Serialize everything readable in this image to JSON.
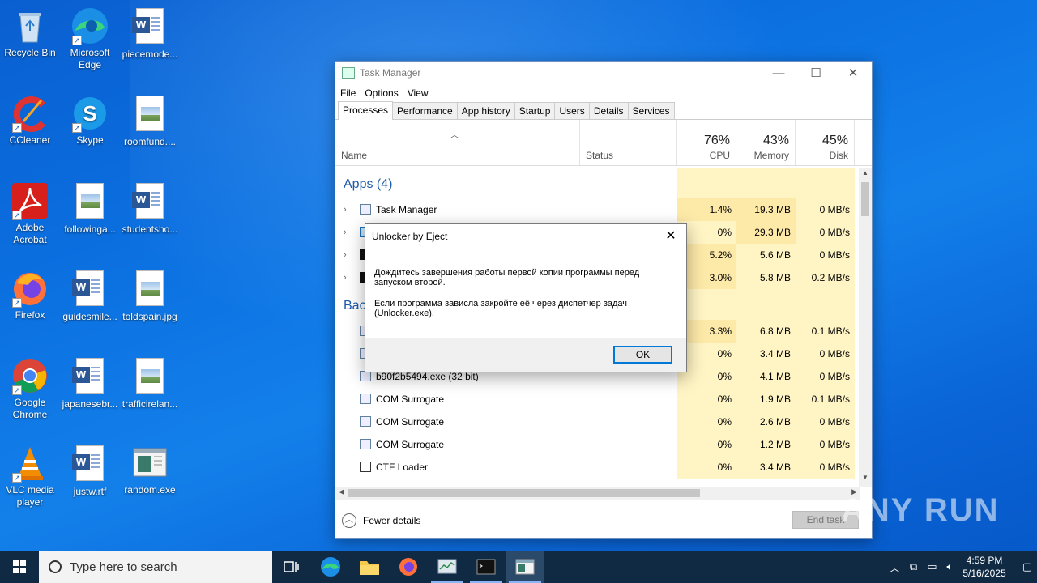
{
  "desktop": {
    "icons": [
      {
        "label": "Recycle Bin"
      },
      {
        "label": "Microsoft Edge"
      },
      {
        "label": "piecemode..."
      },
      {
        "label": "CCleaner"
      },
      {
        "label": "Skype"
      },
      {
        "label": "roomfund...."
      },
      {
        "label": "Adobe Acrobat"
      },
      {
        "label": "followinga..."
      },
      {
        "label": "studentsho..."
      },
      {
        "label": "Firefox"
      },
      {
        "label": "guidesmile..."
      },
      {
        "label": "toldspain.jpg"
      },
      {
        "label": "Google Chrome"
      },
      {
        "label": "japanesebr..."
      },
      {
        "label": "trafficirelan..."
      },
      {
        "label": "VLC media player"
      },
      {
        "label": "justw.rtf"
      },
      {
        "label": "random.exe"
      }
    ]
  },
  "taskmanager": {
    "title": "Task Manager",
    "menu": [
      "File",
      "Options",
      "View"
    ],
    "tabs": [
      "Processes",
      "Performance",
      "App history",
      "Startup",
      "Users",
      "Details",
      "Services"
    ],
    "columns": {
      "name": "Name",
      "status": "Status",
      "cpu_pct": "76%",
      "cpu": "CPU",
      "mem_pct": "43%",
      "mem": "Memory",
      "disk_pct": "45%",
      "disk": "Disk"
    },
    "apps_group": "Apps (4)",
    "bg_group": "Back",
    "apps": [
      {
        "name": "Task Manager",
        "cpu": "1.4%",
        "mem": "19.3 MB",
        "disk": "0 MB/s"
      },
      {
        "name": "",
        "cpu": "0%",
        "mem": "29.3 MB",
        "disk": "0 MB/s"
      },
      {
        "name": "",
        "cpu": "5.2%",
        "mem": "5.6 MB",
        "disk": "0 MB/s"
      },
      {
        "name": "",
        "cpu": "3.0%",
        "mem": "5.8 MB",
        "disk": "0.2 MB/s"
      }
    ],
    "background": [
      {
        "name": "",
        "cpu": "3.3%",
        "mem": "6.8 MB",
        "disk": "0.1 MB/s"
      },
      {
        "name": "",
        "cpu": "0%",
        "mem": "3.4 MB",
        "disk": "0 MB/s"
      },
      {
        "name": "b90f2b5494.exe (32 bit)",
        "cpu": "0%",
        "mem": "4.1 MB",
        "disk": "0 MB/s"
      },
      {
        "name": "COM Surrogate",
        "cpu": "0%",
        "mem": "1.9 MB",
        "disk": "0.1 MB/s"
      },
      {
        "name": "COM Surrogate",
        "cpu": "0%",
        "mem": "2.6 MB",
        "disk": "0 MB/s"
      },
      {
        "name": "COM Surrogate",
        "cpu": "0%",
        "mem": "1.2 MB",
        "disk": "0 MB/s"
      },
      {
        "name": "CTF Loader",
        "cpu": "0%",
        "mem": "3.4 MB",
        "disk": "0 MB/s"
      }
    ],
    "fewer_details": "Fewer details",
    "end_task": "End task"
  },
  "dialog": {
    "title": "Unlocker by Eject",
    "line1": "Дождитесь завершения работы первой копии программы перед запуском второй.",
    "line2": "Если программа зависла закройте её через диспетчер задач (Unlocker.exe).",
    "ok": "OK"
  },
  "taskbar": {
    "search_placeholder": "Type here to search",
    "time": "4:59 PM",
    "date": "5/16/2025"
  },
  "watermark": "ANY RUN"
}
